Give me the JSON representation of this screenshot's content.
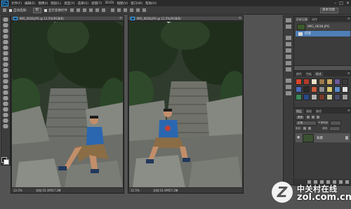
{
  "app": {
    "logo": "Ps",
    "menu": [
      "文件(F)",
      "编辑(E)",
      "图像(I)",
      "图层(L)",
      "类型(Y)",
      "选择(S)",
      "滤镜(T)",
      "3D(D)",
      "视图(V)",
      "窗口(W)",
      "帮助(H)"
    ],
    "window_controls": [
      "–",
      "□",
      "×"
    ]
  },
  "options_bar": {
    "auto_select_label": "自动选择：",
    "auto_select_value": "组",
    "show_transform_label": "显示变换控件",
    "workspace": "基本功能"
  },
  "documents": [
    {
      "tab_title": "IMG_0638.JPG @ 12.5%(RGB/8)",
      "zoom": "12.5%",
      "doc_info": "文档:10.1M/57.2M"
    },
    {
      "tab_title": "IMG_0638.JPG @ 12.5%(RGB/8)",
      "zoom": "12.5%",
      "doc_info": "文档:10.1M/57.2M"
    }
  ],
  "history_panel": {
    "tabs": [
      "历史记录",
      "动作"
    ],
    "snapshot_label": "IMG_0638.JPG",
    "step_label": "打开"
  },
  "swatches_panel": {
    "tabs": [
      "颜色",
      "色板",
      "样式"
    ],
    "style_colors": [
      "#d9452b",
      "#b53a2a",
      "#e8e0c8",
      "#9a7a4a",
      "#c8a860",
      "#6a5a9a",
      "#3a3a3a",
      "#4a6ab8",
      "#2a2a2a",
      "#c85a3a",
      "#8a8a8a",
      "#d8c870",
      "#5a8ac8",
      "#e0e0e0",
      "#3a8a5a",
      "#2a4a8a",
      "#b0b0b0",
      "#7a3a2a",
      "#c8c8a0",
      "#4a4a6a",
      "#9a9a9a"
    ]
  },
  "layers_panel": {
    "tabs": [
      "图层",
      "通道",
      "路径"
    ],
    "kind_label": "类型",
    "blend_mode": "正常",
    "opacity_label": "不透明度:",
    "lock_label": "锁定:",
    "fill_label": "填充:",
    "layer_name": "背景"
  },
  "watermark": {
    "logo_letter": "Z",
    "cn_text": "中关村在线",
    "url": "zol.com.cn"
  }
}
